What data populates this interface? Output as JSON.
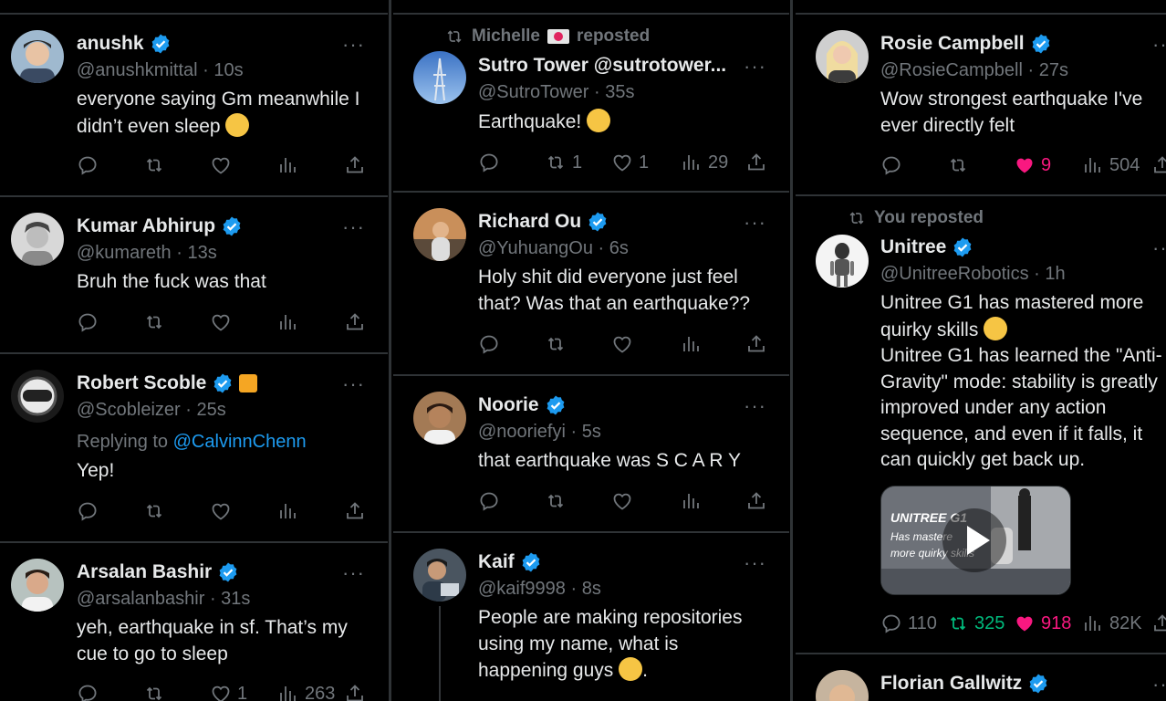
{
  "columns": [
    {
      "tweets": [
        {
          "name": "anushk",
          "handle": "@anushkmittal",
          "time": "10s",
          "text": "everyone saying Gm meanwhile I\ndidn’t even sleep",
          "emoji": "sunglasses-emoji",
          "stats": {
            "reply": "",
            "retweet": "",
            "like": "",
            "views": ""
          }
        },
        {
          "name": "Kumar Abhirup",
          "handle": "@kumareth",
          "time": "13s",
          "text": "Bruh the fuck was that",
          "stats": {
            "reply": "",
            "retweet": "",
            "like": "",
            "views": ""
          }
        },
        {
          "name": "Robert Scoble",
          "handle": "@Scobleizer",
          "time": "25s",
          "reply_prefix": "Replying to",
          "reply_to": "@CalvinnChenn",
          "text": "Yep!",
          "stats": {
            "reply": "",
            "retweet": "",
            "like": "",
            "views": ""
          }
        },
        {
          "name": "Arsalan Bashir",
          "handle": "@arsalanbashir",
          "time": "31s",
          "text": "yeh, earthquake in sf. That’s my\ncue to go to sleep",
          "stats": {
            "reply": "",
            "retweet": "",
            "like": "1",
            "views": "263"
          }
        }
      ]
    },
    {
      "tweets": [
        {
          "repost_by": "Michelle",
          "repost_label": "reposted",
          "name": "Sutro Tower @sutrotower...",
          "handle": "@SutroTower",
          "time": "35s",
          "text": "Earthquake!",
          "emoji": "fearful-face-emoji",
          "stats": {
            "reply": "",
            "retweet": "1",
            "like": "1",
            "views": "29"
          }
        },
        {
          "name": "Richard Ou",
          "handle": "@YuhuangOu",
          "time": "6s",
          "text": "Holy shit did everyone just feel\nthat? Was that an earthquake??",
          "stats": {
            "reply": "",
            "retweet": "",
            "like": "",
            "views": ""
          }
        },
        {
          "name": "Noorie",
          "handle": "@nooriefyi",
          "time": "5s",
          "text": "that earthquake was S C A R Y",
          "stats": {
            "reply": "",
            "retweet": "",
            "like": "",
            "views": ""
          }
        },
        {
          "name": "Kaif",
          "handle": "@kaif9998",
          "time": "8s",
          "text": "People are making repositories\nusing my name, what is\nhappening guys",
          "emoji": "crying-face-emoji",
          "text_suffix": ".",
          "stats": {
            "reply": "",
            "retweet": "",
            "like": "",
            "views": ""
          }
        }
      ]
    },
    {
      "tweets": [
        {
          "name": "Rosie Campbell",
          "handle": "@RosieCampbell",
          "time": "27s",
          "text": "Wow strongest earthquake I've\never directly felt",
          "stats": {
            "reply": "",
            "retweet": "",
            "like": "9",
            "views": "504"
          }
        },
        {
          "repost_label": "You reposted",
          "name": "Unitree",
          "handle": "@UnitreeRobotics",
          "time": "1h",
          "text_line1": "Unitree G1 has mastered more",
          "text_line2": "quirky skills",
          "emoji": "star-struck-emoji",
          "text_rest": "Unitree G1 has learned the \"Anti-\nGravity\" mode: stability is greatly\nimproved under any action\nsequence, and even if it falls, it\ncan quickly get back up.",
          "media": {
            "title": "UNITREE G1",
            "caption1": "Has mastere",
            "caption2": "more quirky skills"
          },
          "stats": {
            "reply": "110",
            "retweet": "325",
            "like": "918",
            "views": "82K"
          }
        },
        {
          "name": "Florian Gallwitz",
          "handle": "",
          "time": "",
          "text": "",
          "stats": {
            "reply": "",
            "retweet": "",
            "like": "",
            "views": ""
          }
        }
      ]
    }
  ],
  "colors": {
    "background": "#000000",
    "text": "#e7e9ea",
    "muted": "#71767b",
    "blue": "#1d9bf0",
    "green": "#00ba7c",
    "pink": "#f91880",
    "border": "#2f3336"
  },
  "icons": [
    "reply-icon",
    "retweet-icon",
    "like-icon",
    "views-icon",
    "share-icon",
    "verified-badge-icon",
    "more-icon"
  ],
  "ui": {
    "more": "···",
    "dot": "·"
  }
}
